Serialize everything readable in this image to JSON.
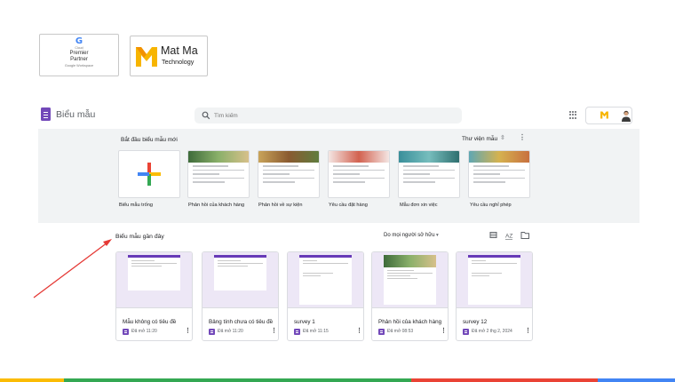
{
  "badges": {
    "google": {
      "g": "G",
      "cloud": "Cloud",
      "line1": "Premier",
      "line2": "Partner",
      "line3": "Google Workspace"
    },
    "matma": {
      "name": "Mat Ma",
      "sub": "Technology"
    }
  },
  "header": {
    "app_title": "Biểu mẫu",
    "search_placeholder": "Tìm kiếm"
  },
  "gallery": {
    "start_label": "Bắt đầu biểu mẫu mới",
    "library_label": "Thư viện mẫu",
    "templates": [
      {
        "label": "Biểu mẫu trống"
      },
      {
        "label": "Phản hồi của khách hàng"
      },
      {
        "label": "Phản hồi về sự kiện"
      },
      {
        "label": "Yêu cầu đặt hàng"
      },
      {
        "label": "Mẫu đơn xin việc"
      },
      {
        "label": "Yêu cầu nghỉ phép"
      }
    ]
  },
  "recent": {
    "title": "Biểu mẫu gần đây",
    "owner_filter": "Do mọi người sở hữu",
    "cards": [
      {
        "title": "Mẫu không có tiêu đề",
        "opened": "Đã mở 11:20"
      },
      {
        "title": "Bảng tính chưa có tiêu đề",
        "opened": "Đã mở 11:20"
      },
      {
        "title": "survey 1",
        "opened": "Đã mở 11:15"
      },
      {
        "title": "Phản hồi của khách hàng",
        "opened": "Đã mở 08:53"
      },
      {
        "title": "survey 12",
        "opened": "Đã mở 2 thg 2, 2024"
      }
    ]
  },
  "colors": {
    "forms_purple": "#7248b9",
    "gallery_bg": "#f1f3f4",
    "annotation_arrow": "#e53935"
  }
}
